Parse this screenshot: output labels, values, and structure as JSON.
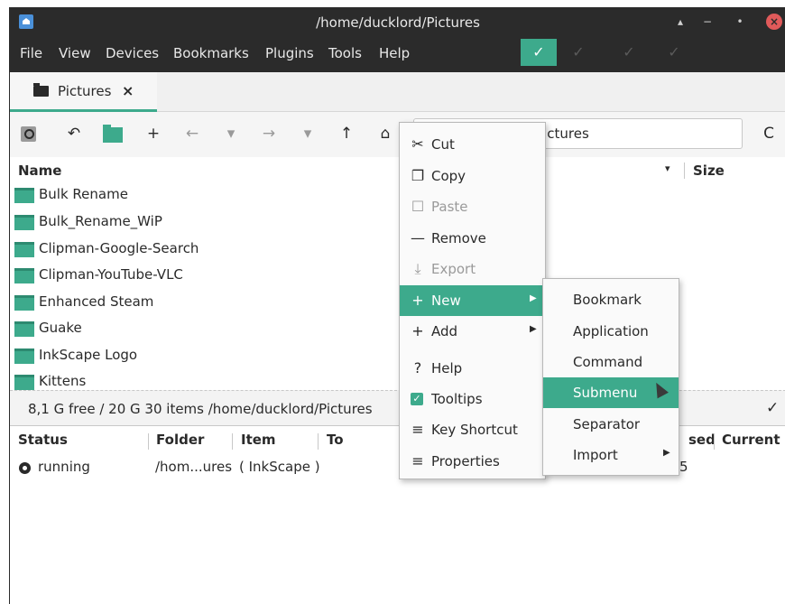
{
  "window": {
    "title": "/home/ducklord/Pictures",
    "controls": {
      "minimize": "−",
      "maximize": "▴",
      "restore": "•",
      "close": "×"
    }
  },
  "menubar": {
    "items": [
      "File",
      "View",
      "Devices",
      "Bookmarks",
      "Plugins",
      "Tools",
      "Help"
    ],
    "checks": [
      "✓",
      "✓",
      "✓",
      "✓"
    ]
  },
  "tabs": [
    {
      "label": "Pictures",
      "close": "×"
    }
  ],
  "toolbar": {
    "icons": [
      "search-icon",
      "undo-icon",
      "folder-icon",
      "plus-icon",
      "back-arrow-icon",
      "dropdown-icon",
      "forward-arrow-icon",
      "dropdown-icon",
      "up-arrow-icon",
      "home-icon",
      "refresh-icon"
    ],
    "glyphs": {
      "undo": "↶",
      "plus": "+",
      "back": "←",
      "dropdown": "▾",
      "forward": "→",
      "up": "↑",
      "home": "⌂",
      "refresh": "C"
    },
    "path_value": "/home/ducklord/Pictures"
  },
  "filelist": {
    "columns": {
      "name": "Name",
      "size": "Size",
      "sort": "▾"
    },
    "rows": [
      "Bulk Rename",
      "Bulk_Rename_WiP",
      "Clipman-Google-Search",
      "Clipman-YouTube-VLC",
      "Enhanced Steam",
      "Guake",
      "InkScape Logo",
      "Kittens"
    ]
  },
  "statusbar": {
    "text": "8,1 G free / 20 G  30 items  /home/ducklord/Pictures",
    "check": "✓"
  },
  "jobs": {
    "columns": [
      "Status",
      "Folder",
      "Item",
      "To",
      "sed",
      "Current"
    ],
    "rows": [
      {
        "status": "running",
        "folder": "/hom...ures",
        "item": "( InkScape )",
        "used": "5"
      }
    ]
  },
  "context_menu": {
    "items": [
      {
        "label": "Cut",
        "icon": "✂"
      },
      {
        "label": "Copy",
        "icon": "❐"
      },
      {
        "label": "Paste",
        "icon": "☐"
      },
      {
        "label": "Remove",
        "icon": "—"
      },
      {
        "label": "Export",
        "icon": "⤓"
      },
      {
        "label": "New",
        "icon": "+",
        "arrow": "▶"
      },
      {
        "label": "Add",
        "icon": "+",
        "arrow": "▶"
      },
      {
        "label": "Help",
        "icon": "?"
      },
      {
        "label": "Tooltips",
        "icon": "✓"
      },
      {
        "label": "Key Shortcut",
        "icon": "≡"
      },
      {
        "label": "Properties",
        "icon": "≡"
      }
    ]
  },
  "submenu": {
    "items": [
      {
        "label": "Bookmark"
      },
      {
        "label": "Application"
      },
      {
        "label": "Command"
      },
      {
        "label": "Submenu"
      },
      {
        "label": "Separator"
      },
      {
        "label": "Import",
        "arrow": "▶"
      }
    ]
  },
  "colors": {
    "accent": "#3daa8c",
    "titlebar": "#2b2b2b",
    "close": "#e05a5a"
  }
}
